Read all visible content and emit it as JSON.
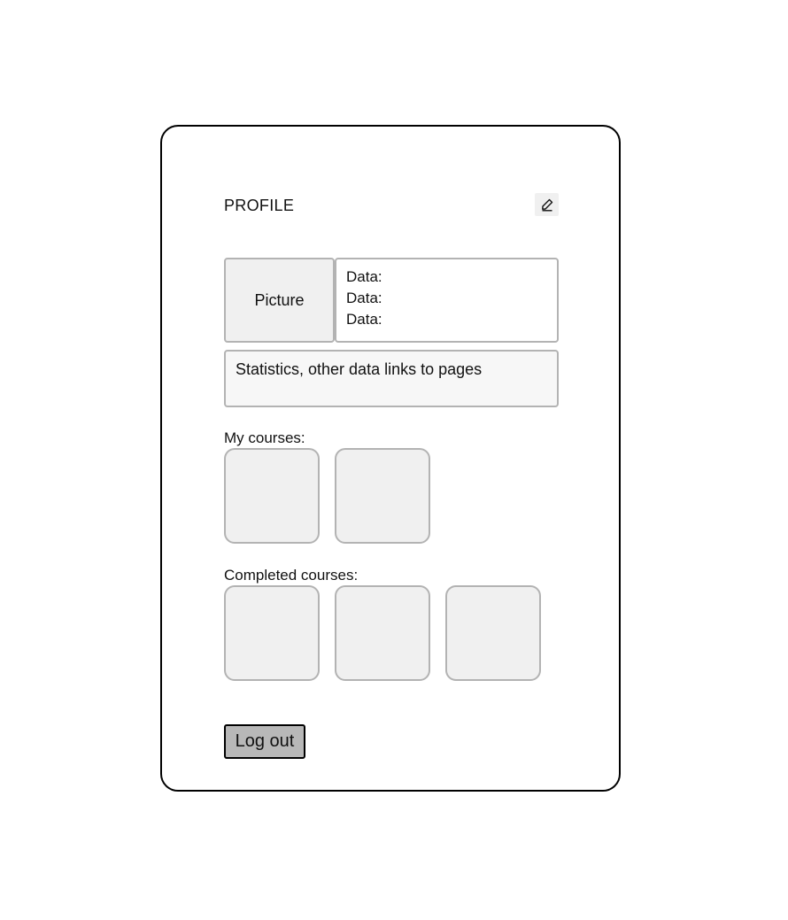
{
  "profile": {
    "title": "PROFILE",
    "edit_icon": "pencil-icon"
  },
  "info": {
    "picture_label": "Picture",
    "data_lines": [
      "Data:",
      "Data:",
      "Data:"
    ],
    "stats_text": "Statistics, other data links to pages"
  },
  "my_courses": {
    "label": "My courses:",
    "count": 2
  },
  "completed_courses": {
    "label": "Completed courses:",
    "count": 3
  },
  "actions": {
    "logout_label": "Log out"
  }
}
